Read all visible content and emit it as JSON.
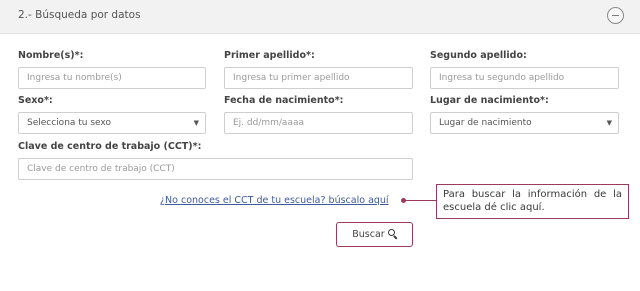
{
  "section": {
    "title": "2.- Búsqueda por datos",
    "collapse_icon": "minus-circle-icon"
  },
  "form": {
    "nombre": {
      "label": "Nombre(s)*:",
      "placeholder": "Ingresa tu nombre(s)"
    },
    "primer_apellido": {
      "label": "Primer apellido*:",
      "placeholder": "Ingresa tu primer apellido"
    },
    "segundo_apellido": {
      "label": "Segundo apellido:",
      "placeholder": "Ingresa tu segundo apellido"
    },
    "sexo": {
      "label": "Sexo*:",
      "selected": "Selecciona tu sexo"
    },
    "fecha_nacimiento": {
      "label": "Fecha de nacimiento*:",
      "placeholder": "Ej. dd/mm/aaaa"
    },
    "lugar_nacimiento": {
      "label": "Lugar de nacimiento*:",
      "selected": "Lugar de nacimiento"
    },
    "cct": {
      "label": "Clave de centro de trabajo (CCT)*:",
      "placeholder": "Clave de centro de trabajo (CCT)"
    }
  },
  "help": {
    "link_text": "¿No conoces el CCT de tu escuela? búscalo aquí",
    "callout_text": "Para buscar la información de la escuela dé clic aquí."
  },
  "search_button": {
    "label": "Buscar",
    "icon": "search-icon"
  },
  "colors": {
    "accent": "#9b3a5c",
    "link": "#3f5b9c",
    "header_bg": "#f2f2f2"
  }
}
